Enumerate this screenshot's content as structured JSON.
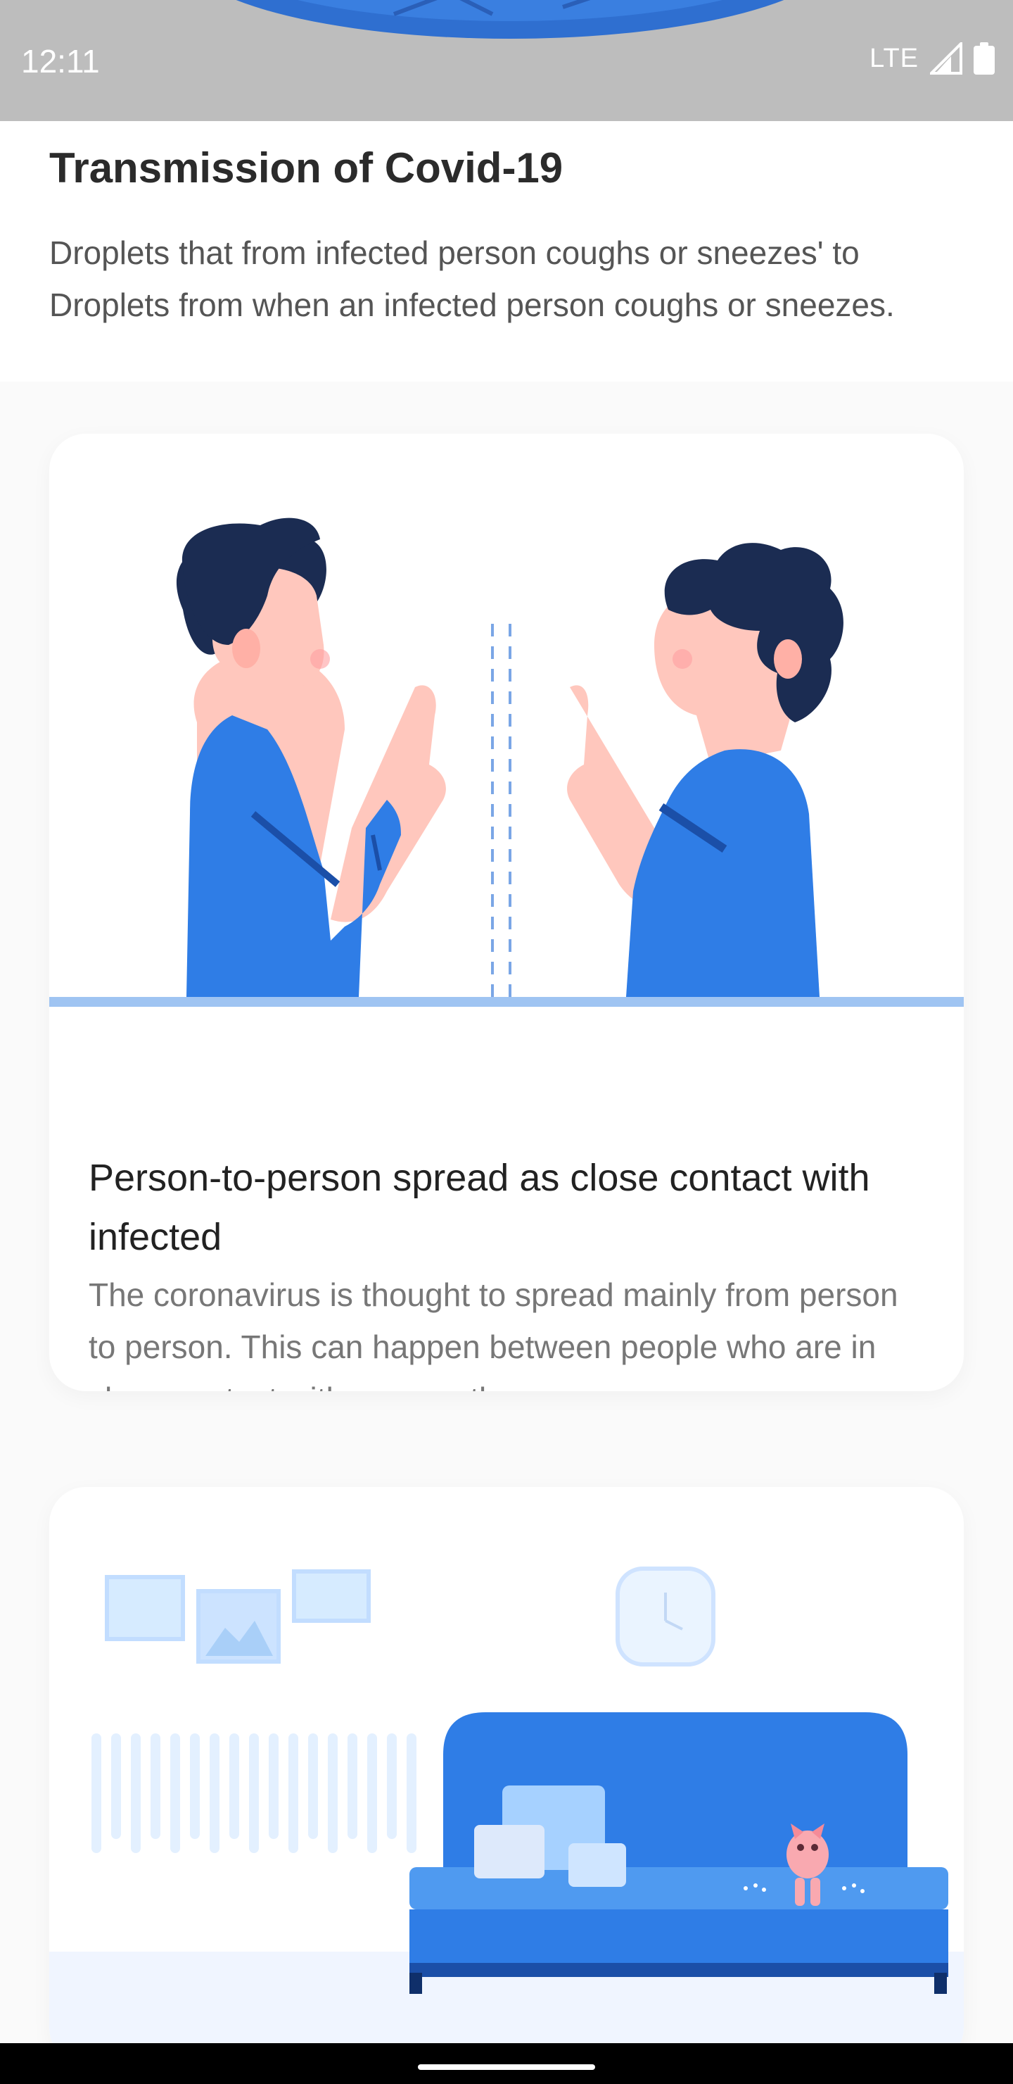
{
  "status_bar": {
    "time": "12:11",
    "network": "LTE",
    "icons": [
      "signal-icon",
      "battery-icon"
    ],
    "background": "#bdbdbd"
  },
  "header": {
    "title": "Transmission of Covid-19",
    "description": "Droplets that from infected person coughs or sneezes' to Droplets from when an infected person coughs or sneezes."
  },
  "cards": [
    {
      "title": "Person-to-person spread as close contact with infected",
      "description": "The coronavirus is thought to spread mainly from person to person. This can happen between people who are in close contact with one another.",
      "illustration": "two-people-distance-illustration"
    },
    {
      "illustration": "living-room-sofa-illustration"
    }
  ],
  "colors": {
    "accent_blue": "#2f7de6",
    "hair_navy": "#1b2c52",
    "skin": "#ffc7bd",
    "divider_blue": "#9fc4f2"
  }
}
